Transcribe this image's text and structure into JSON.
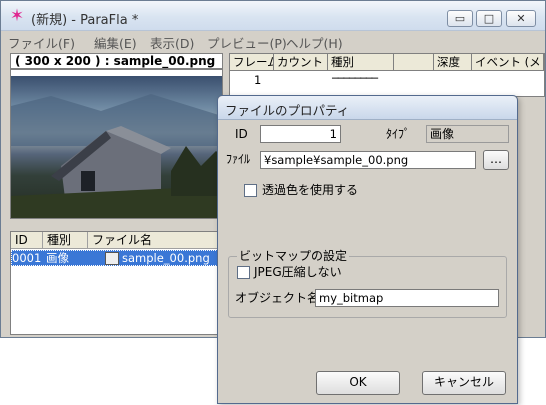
{
  "window": {
    "title": "(新規) - ParaFla *"
  },
  "caption_buttons": {
    "minimize": "▭",
    "maximize": "□",
    "close": "✕"
  },
  "menu": [
    "ファイル(F)",
    "編集(E)",
    "表示(D)",
    "プレビュー(P)",
    "ヘルプ(H)"
  ],
  "preview": {
    "caption": "( 300 x 200 ) : sample_00.png"
  },
  "file_list": {
    "headers": [
      "ID",
      "種別",
      "ファイル名"
    ],
    "rows": [
      {
        "id": "0001",
        "type": "画像",
        "name": "sample_00.png"
      }
    ]
  },
  "timeline": {
    "headers": [
      "フレーム",
      "カウント",
      "種別",
      "",
      "深度",
      "イベント (メ"
    ],
    "rows": [
      {
        "frame": "1",
        "type": "────────"
      }
    ]
  },
  "dialog": {
    "title": "ファイルのプロパティ",
    "id_label": "ID",
    "id_value": "1",
    "type_label": "ﾀｲﾌﾟ",
    "type_value": "画像",
    "file_label": "ﾌｧｲﾙ",
    "file_value": "¥sample¥sample_00.png",
    "browse_label": "…",
    "transparent_label": "透過色を使用する",
    "bitmap_group_label": "ビットマップの設定",
    "jpeg_label": "JPEG圧縮しない",
    "object_name_label": "オブジェクト名",
    "object_name_value": "my_bitmap",
    "ok_label": "OK",
    "cancel_label": "キャンセル"
  }
}
